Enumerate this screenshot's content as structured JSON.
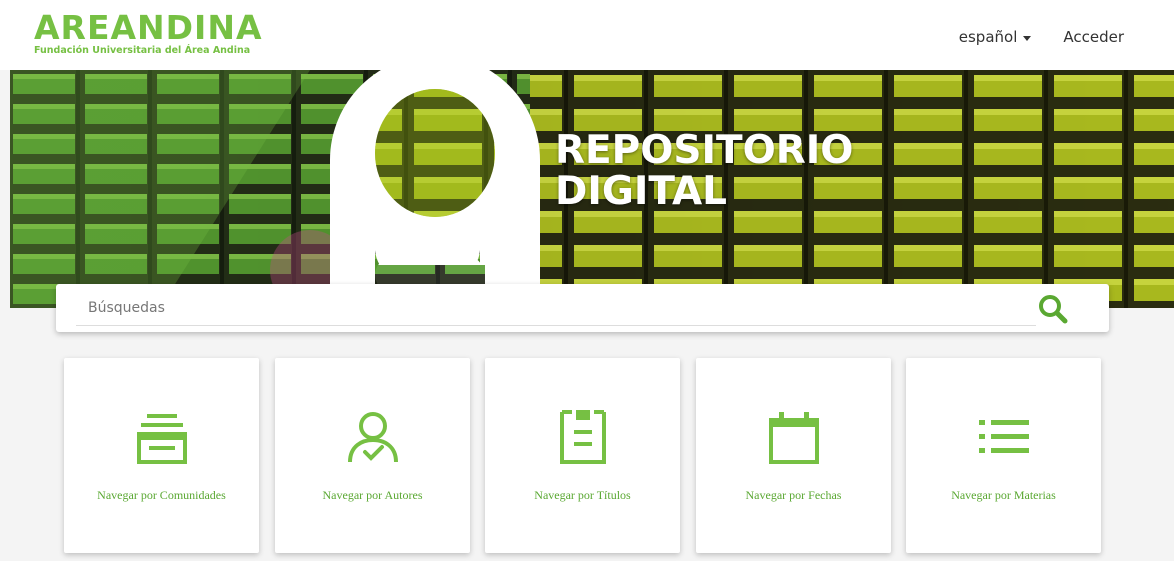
{
  "header": {
    "logo_text": "AREANDINA",
    "logo_subtitle": "Fundación Universitaria del Área Andina",
    "language_label": "español",
    "login_label": "Acceder"
  },
  "banner": {
    "title_line1": "REPOSITORIO",
    "title_line2": "DIGITAL"
  },
  "search": {
    "placeholder": "Búsquedas",
    "button_icon": "search-icon"
  },
  "cards": [
    {
      "label": "Navegar por Comunidades",
      "icon": "archive-box-icon"
    },
    {
      "label": "Navegar por Autores",
      "icon": "user-check-icon"
    },
    {
      "label": "Navegar por Títulos",
      "icon": "document-icon"
    },
    {
      "label": "Navegar por Fechas",
      "icon": "calendar-icon"
    },
    {
      "label": "Navegar por Materias",
      "icon": "list-icon"
    }
  ],
  "colors": {
    "brand_green": "#76c043",
    "card_label_green": "#5aa832"
  }
}
